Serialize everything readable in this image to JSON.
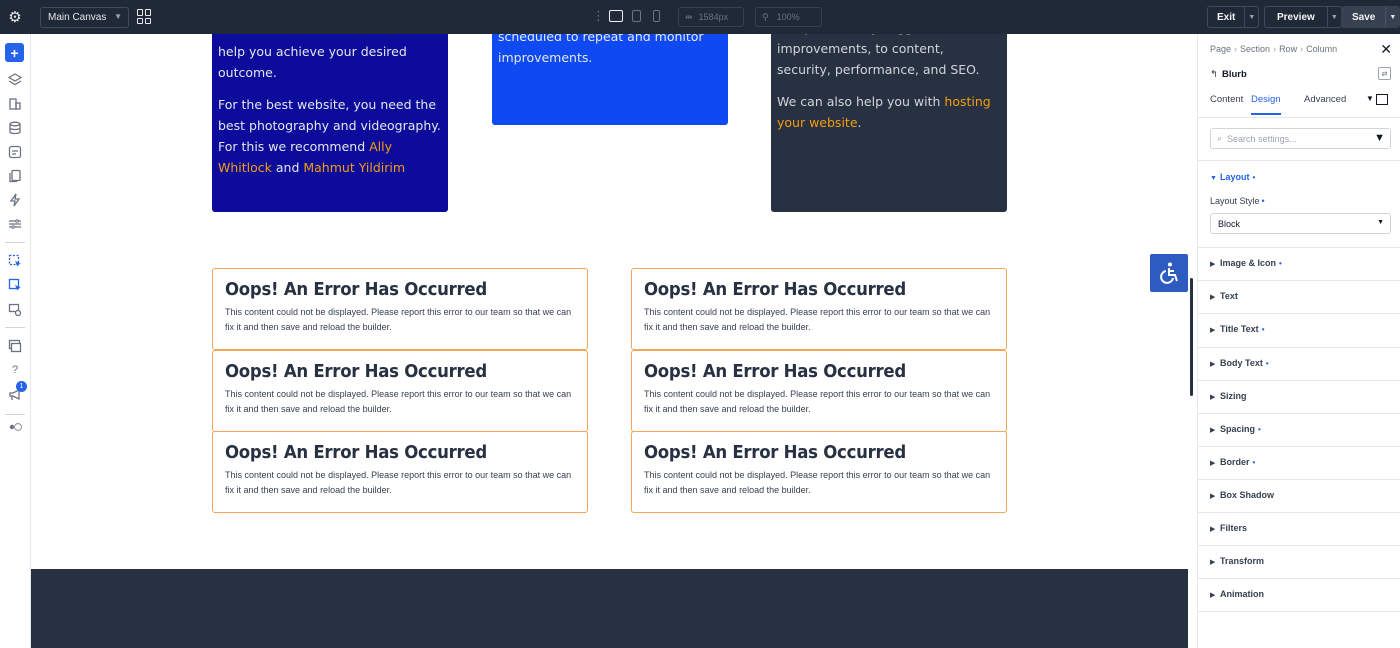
{
  "topbar": {
    "canvas_label": "Main Canvas",
    "width_value": "1584px",
    "zoom_value": "100%",
    "exit_label": "Exit",
    "preview_label": "Preview",
    "save_label": "Save"
  },
  "rail": {
    "badge_count": "1"
  },
  "canvas": {
    "card1": {
      "line1": "help you achieve your desired outcome.",
      "para2_pre": "For the best website, you need the best photography and videography. For this we recommend ",
      "link1": "Ally Whitlock",
      "mid": " and ",
      "link2": "Mahmut Yildirim"
    },
    "card2": {
      "text": "scheduled to repeat and monitor improvements."
    },
    "card3": {
      "para1": "and pro-actively suggest improvements, to content, security, performance, and SEO.",
      "para2_pre": "We can also help you with ",
      "link": "hosting your website",
      "para2_post": "."
    },
    "errors": [
      {
        "title": "Oops! An Error Has Occurred",
        "body": "This content could not be displayed. Please report this error to our team so that we can fix it and then save and reload the builder."
      },
      {
        "title": "Oops! An Error Has Occurred",
        "body": "This content could not be displayed. Please report this error to our team so that we can fix it and then save and reload the builder."
      },
      {
        "title": "Oops! An Error Has Occurred",
        "body": "This content could not be displayed. Please report this error to our team so that we can fix it and then save and reload the builder."
      },
      {
        "title": "Oops! An Error Has Occurred",
        "body": "This content could not be displayed. Please report this error to our team so that we can fix it and then save and reload the builder."
      },
      {
        "title": "Oops! An Error Has Occurred",
        "body": "This content could not be displayed. Please report this error to our team so that we can fix it and then save and reload the builder."
      },
      {
        "title": "Oops! An Error Has Occurred",
        "body": "This content could not be displayed. Please report this error to our team so that we can fix it and then save and reload the builder."
      }
    ]
  },
  "panel": {
    "breadcrumb": [
      "Page",
      "Section",
      "Row",
      "Column"
    ],
    "module_title": "Blurb",
    "tabs": [
      "Content",
      "Design",
      "Advanced"
    ],
    "search_placeholder": "Search settings...",
    "layout_group": "Layout",
    "layout_style_label": "Layout Style",
    "layout_style_value": "Block",
    "groups": [
      "Image & Icon",
      "Text",
      "Title Text",
      "Body Text",
      "Sizing",
      "Spacing",
      "Border",
      "Box Shadow",
      "Filters",
      "Transform",
      "Animation"
    ]
  },
  "colors": {
    "accent": "#2563eb",
    "card1_bg": "#0c0b9b",
    "card2_bg": "#0f49f2",
    "card3_bg": "#273142",
    "error_border": "#f2a65a",
    "link_orange": "#f59e0b"
  }
}
